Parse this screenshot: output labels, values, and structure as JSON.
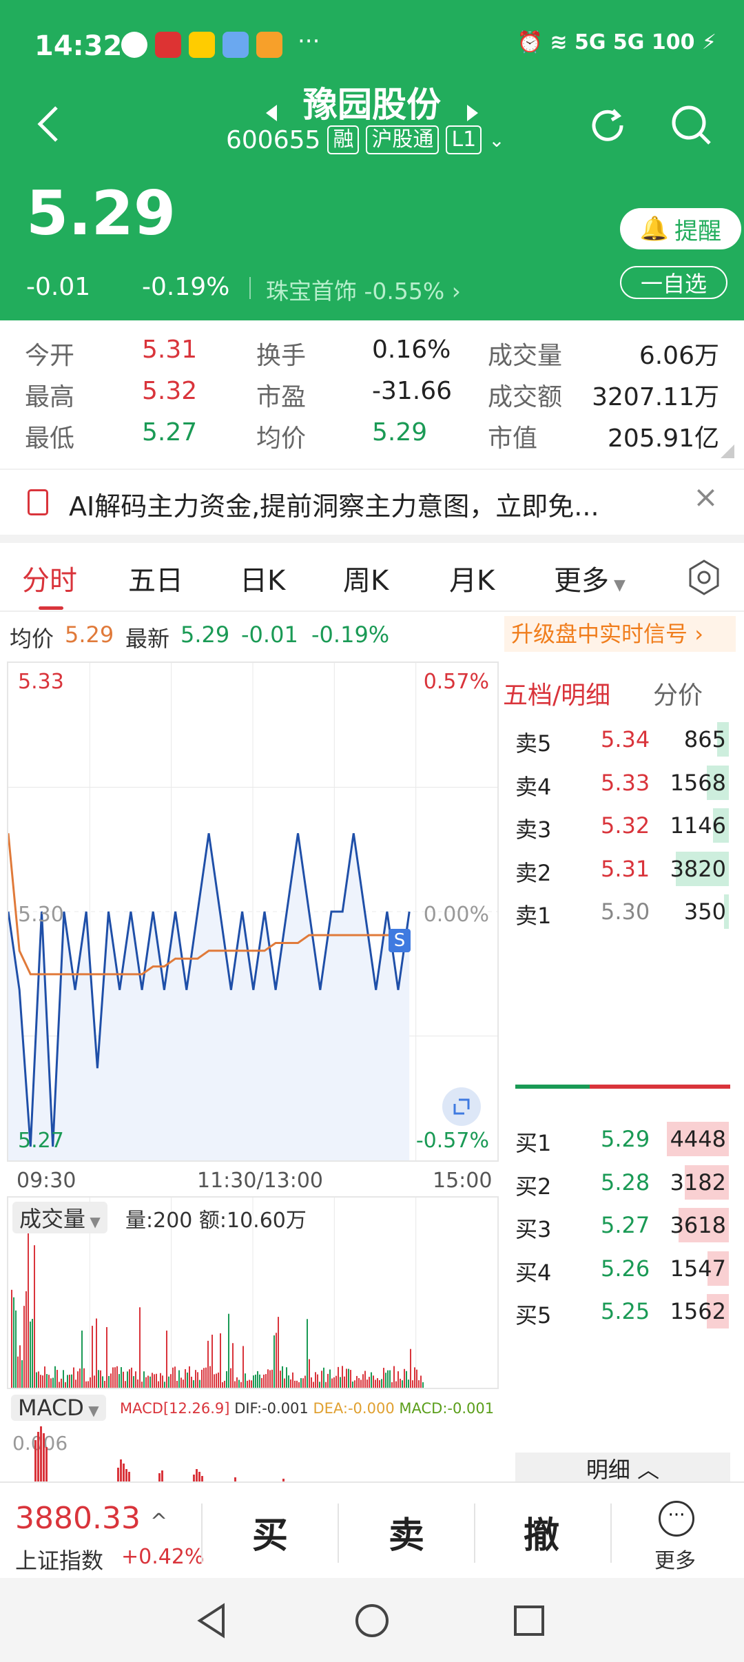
{
  "status_bar": {
    "time": "14:32",
    "signal_right": "5G 5G 100"
  },
  "header": {
    "title": "豫园股份",
    "code": "600655",
    "tags": [
      "融",
      "沪股通",
      "L1"
    ],
    "price": "5.29",
    "change": "-0.01",
    "change_pct": "-0.19%",
    "sector_name": "珠宝首饰",
    "sector_pct": "-0.55%",
    "remind_label": "提醒",
    "watch_label": "一自选"
  },
  "stats": {
    "open_label": "今开",
    "open": "5.31",
    "turnover_label": "换手",
    "turnover": "0.16%",
    "volume_label": "成交量",
    "volume": "6.06万",
    "high_label": "最高",
    "high": "5.32",
    "pe_label": "市盈",
    "pe": "-31.66",
    "amount_label": "成交额",
    "amount": "3207.11万",
    "low_label": "最低",
    "low": "5.27",
    "avg_label": "均价",
    "avg": "5.29",
    "mcap_label": "市值",
    "mcap": "205.91亿"
  },
  "notice": {
    "text": "AI解码主力资金,提前洞察主力意图，立即免..."
  },
  "tabs": [
    "分时",
    "五日",
    "日K",
    "周K",
    "月K",
    "更多"
  ],
  "info_line": {
    "avg_label": "均价",
    "avg": "5.29",
    "latest_label": "最新",
    "latest": "5.29",
    "change": "-0.01",
    "change_pct": "-0.19%",
    "upgrade": "升级盘中实时信号"
  },
  "chart": {
    "y_top": "5.33",
    "y_bottom": "5.27",
    "y_mid": "5.30",
    "pct_top": "0.57%",
    "pct_mid": "0.00%",
    "pct_bottom": "-0.57%",
    "t_start": "09:30",
    "t_mid": "11:30/13:00",
    "t_end": "15:00",
    "vol_label": "成交量",
    "vol_info": "量:200 额:10.60万",
    "macd_label": "MACD",
    "macd_params": "MACD[12.26.9]",
    "dif": "DIF:-0.001",
    "dea": "DEA:-0.000",
    "macd_val": "MACD:-0.001",
    "macd_top": "0.006"
  },
  "chart_data": {
    "type": "line",
    "series": [
      {
        "values": [
          5.3,
          5.29,
          5.27,
          5.3,
          5.27,
          5.3,
          5.29,
          5.3,
          5.28,
          5.3,
          5.29,
          5.3,
          5.29,
          5.3,
          5.29,
          5.3,
          5.29,
          5.3,
          5.31,
          5.3,
          5.29,
          5.3,
          5.29,
          5.3,
          5.29,
          5.3,
          5.31,
          5.3,
          5.29,
          5.3,
          5.3,
          5.31,
          5.3,
          5.29,
          5.3,
          5.29,
          5.3
        ]
      },
      {
        "values": [
          5.31,
          5.295,
          5.292,
          5.292,
          5.292,
          5.292,
          5.292,
          5.292,
          5.292,
          5.292,
          5.292,
          5.292,
          5.292,
          5.293,
          5.293,
          5.294,
          5.294,
          5.294,
          5.295,
          5.295,
          5.295,
          5.295,
          5.295,
          5.295,
          5.296,
          5.296,
          5.296,
          5.297,
          5.297,
          5.297,
          5.297,
          5.297,
          5.297,
          5.297,
          5.297,
          5.297,
          5.297
        ]
      }
    ],
    "ylim": [
      5.27,
      5.33
    ]
  },
  "orderbook": {
    "title": "五档/明细",
    "sub": "分价",
    "asks": [
      {
        "label": "卖5",
        "price": "5.34",
        "vol": "865"
      },
      {
        "label": "卖4",
        "price": "5.33",
        "vol": "1568"
      },
      {
        "label": "卖3",
        "price": "5.32",
        "vol": "1146"
      },
      {
        "label": "卖2",
        "price": "5.31",
        "vol": "3820"
      },
      {
        "label": "卖1",
        "price": "5.30",
        "vol": "350"
      }
    ],
    "bids": [
      {
        "label": "买1",
        "price": "5.29",
        "vol": "4448"
      },
      {
        "label": "买2",
        "price": "5.28",
        "vol": "3182"
      },
      {
        "label": "买3",
        "price": "5.27",
        "vol": "3618"
      },
      {
        "label": "买4",
        "price": "5.26",
        "vol": "1547"
      },
      {
        "label": "买5",
        "price": "5.25",
        "vol": "1562"
      }
    ],
    "detail": "明细"
  },
  "bottom": {
    "index_value": "3880.33",
    "index_name": "上证指数",
    "index_pct": "+0.42%",
    "buy": "买",
    "sell": "卖",
    "cancel": "撤",
    "more": "更多"
  },
  "colors": {
    "header_green": "#22ad5c",
    "up_red": "#d9343b",
    "down_green": "#1a9a55",
    "price_line": "#1f4fa8",
    "avg_line": "#e07a3a"
  }
}
